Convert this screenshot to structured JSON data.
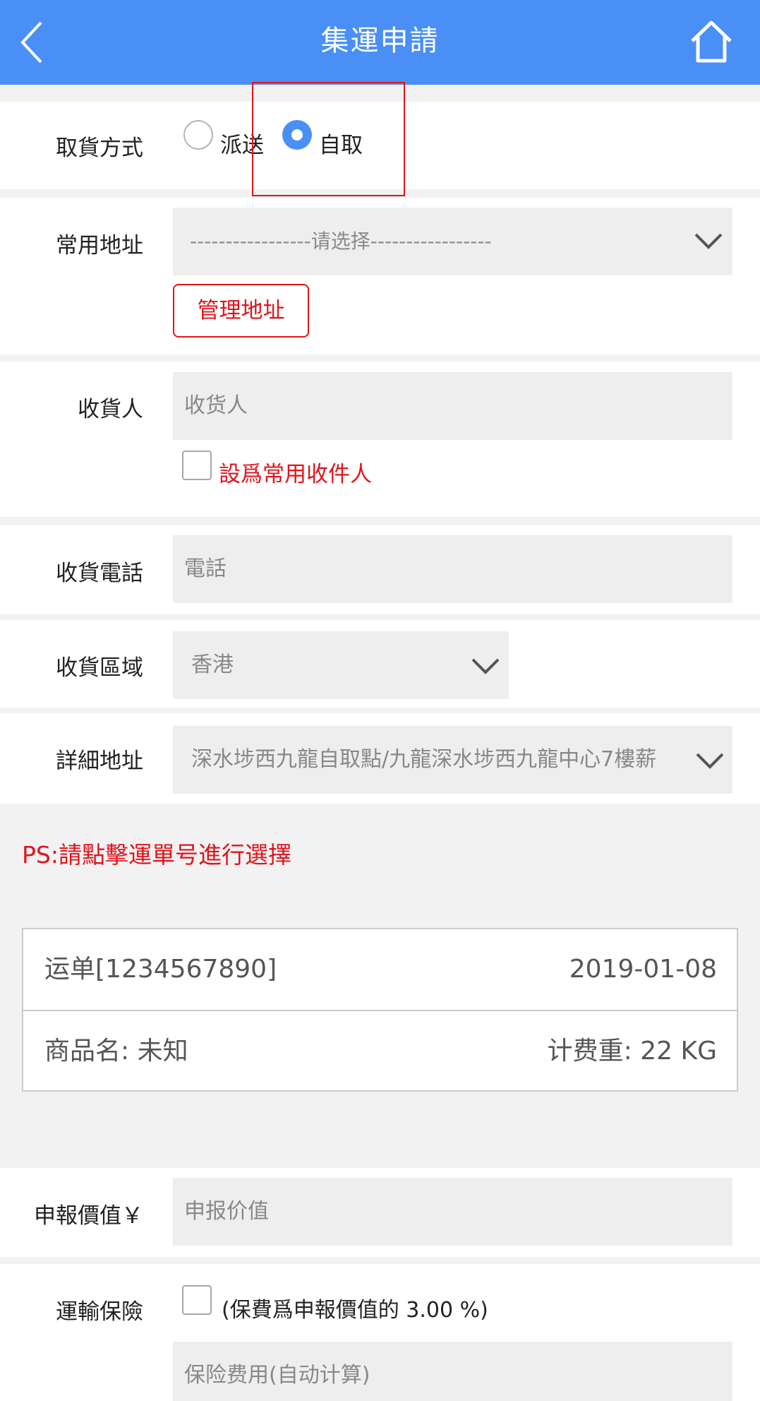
{
  "header": {
    "title": "集運申請",
    "back_icon": "back-arrow-icon",
    "home_icon": "home-icon"
  },
  "pickup": {
    "label": "取貨方式",
    "options": [
      {
        "label": "派送",
        "checked": false
      },
      {
        "label": "自取",
        "checked": true
      }
    ]
  },
  "common_address": {
    "label": "常用地址",
    "select_value": "-----------------请选择-----------------",
    "manage_button": "管理地址"
  },
  "receiver": {
    "label": "收貨人",
    "placeholder": "收货人",
    "checkbox_label": "設爲常用收件人"
  },
  "phone": {
    "label": "收貨電話",
    "placeholder": "電話"
  },
  "region": {
    "label": "收貨區域",
    "value": "香港"
  },
  "detail_address": {
    "label": "詳細地址",
    "value": "深水埗西九龍自取點/九龍深水埗西九龍中心7樓薪"
  },
  "notice": "PS:請點擊運單号進行選擇",
  "waybill": {
    "number": "运单[1234567890]",
    "date": "2019-01-08",
    "product": "商品名: 未知",
    "weight": "计费重: 22 KG"
  },
  "declared_value": {
    "label": "申報價值￥",
    "placeholder": "申报价值"
  },
  "insurance": {
    "label": "運輸保險",
    "checkbox_label": "(保費爲申報價值的 3.00 %)",
    "fee_placeholder": "保险费用(自动计算)"
  },
  "colors": {
    "accent": "#4a8ff5",
    "warning": "#e0141c"
  }
}
